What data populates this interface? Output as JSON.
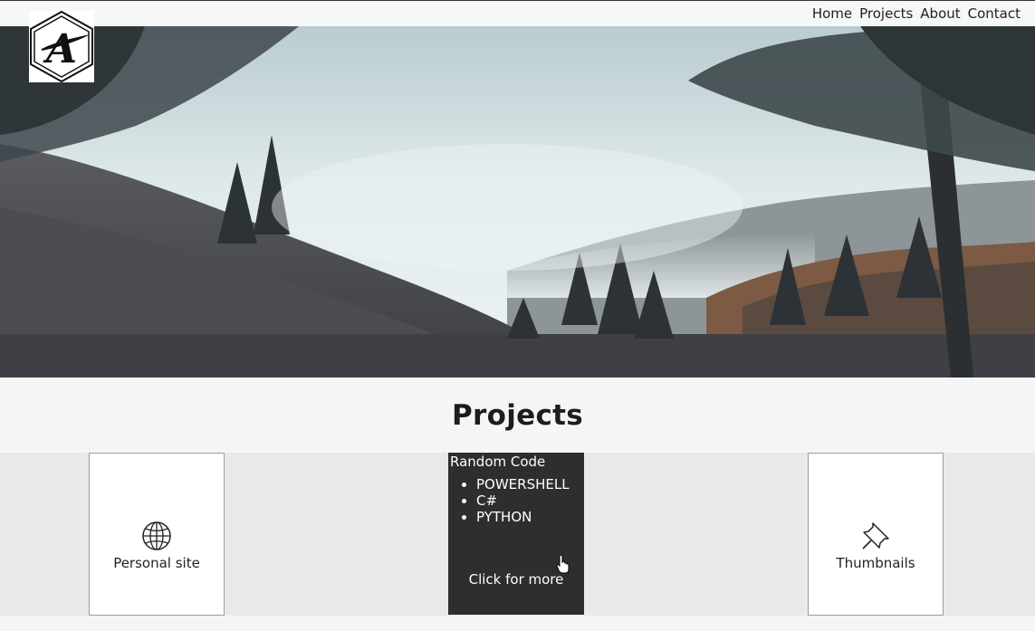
{
  "nav": {
    "items": [
      "Home",
      "Projects",
      "About",
      "Contact"
    ]
  },
  "logo": {
    "text": "A",
    "icon": "logo-hexagon-icon"
  },
  "hero": {
    "icon": "forest-mountain-photo"
  },
  "section": {
    "title": "Projects"
  },
  "cards": {
    "personal": {
      "label": "Personal site",
      "icon": "globe-icon"
    },
    "code": {
      "title": "Random Code",
      "items": [
        "POWERSHELL",
        "C#",
        "PYTHON"
      ],
      "more": "Click for more"
    },
    "thumbnails": {
      "label": "Thumbnails",
      "icon": "pushpin-icon"
    }
  },
  "colors": {
    "dark_card": "#2e2e2e",
    "band": "#e9e9e9",
    "page": "#f4f6f6"
  }
}
